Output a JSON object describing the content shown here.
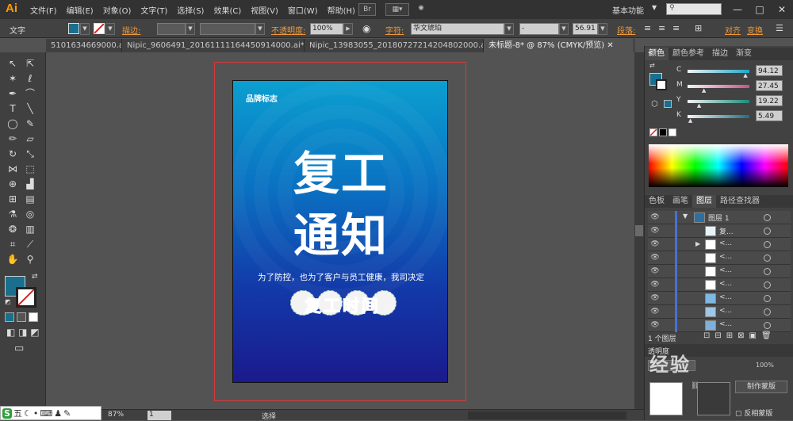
{
  "app": {
    "logo": "Ai",
    "workspace": "基本功能",
    "search_placeholder": ""
  },
  "menu": [
    "文件(F)",
    "编辑(E)",
    "对象(O)",
    "文字(T)",
    "选择(S)",
    "效果(C)",
    "视图(V)",
    "窗口(W)",
    "帮助(H)"
  ],
  "window_buttons": {
    "minimize": "—",
    "restore": "□",
    "close": "✕"
  },
  "control": {
    "tool_label": "文字",
    "stroke_label": "描边:",
    "opacity_label": "不透明度:",
    "opacity_value": "100%",
    "char_label": "字符:",
    "font_value": "华文琥珀",
    "style_value": "-",
    "size_value": "56.91",
    "para_label": "段落:",
    "align_label": "对齐",
    "transform_label": "变换"
  },
  "tabs": [
    {
      "label": "5101634669000.ai* ✕",
      "active": false
    },
    {
      "label": "Nipic_9606491_20161111164450914000.ai* ✕",
      "active": false
    },
    {
      "label": "Nipic_13983055_20180727214204802000.ai* ✕",
      "active": false
    },
    {
      "label": "未标题-8* @ 87% (CMYK/预览) ✕",
      "active": true
    }
  ],
  "poster": {
    "brand": "品牌标志",
    "line1": "复工",
    "line2": "通知",
    "subtitle": "为了防控，也为了客户与员工健康，我司决定",
    "badge": "复工时间"
  },
  "color_panel": {
    "tabs": [
      "颜色",
      "颜色参考",
      "描边",
      "渐变"
    ],
    "channels": [
      {
        "label": "C",
        "value": "94.12",
        "level": 0.94,
        "track": "#21a7c7"
      },
      {
        "label": "M",
        "value": "27.45",
        "level": 0.27,
        "track": "#c8508a"
      },
      {
        "label": "Y",
        "value": "19.22",
        "level": 0.19,
        "track": "#1e8a7a"
      },
      {
        "label": "K",
        "value": "5.49",
        "level": 0.05,
        "track": "#1a6f85"
      }
    ],
    "fill_color": "#1a6f8f"
  },
  "layers_panel": {
    "tabs": [
      "色板",
      "画笔",
      "图层",
      "路径查找器"
    ],
    "rows": [
      {
        "name": "图层 1",
        "thumb": "#2d6fa0"
      },
      {
        "name": "复...",
        "thumb": "#e8f3f7"
      },
      {
        "name": "<...",
        "thumb": "#ffffff"
      },
      {
        "name": "<...",
        "thumb": "#ffffff"
      },
      {
        "name": "<...",
        "thumb": "#ffffff"
      },
      {
        "name": "<...",
        "thumb": "#ffffff"
      },
      {
        "name": "<...",
        "thumb": "#7fb8e0"
      },
      {
        "name": "<...",
        "thumb": "#9fc6e5"
      },
      {
        "name": "<...",
        "thumb": "#7fb0da"
      }
    ],
    "footer": "1 个图层",
    "make_mask": "制作蒙版",
    "invert_mask": "反相蒙版",
    "opacity_value": "100%"
  },
  "status": {
    "zoom": "87%",
    "page": "1",
    "tool": "选择"
  },
  "ime": {
    "items": [
      "S",
      "五",
      "☾",
      "•",
      "⌨",
      "♟",
      "✎"
    ]
  },
  "watermark": "经验"
}
